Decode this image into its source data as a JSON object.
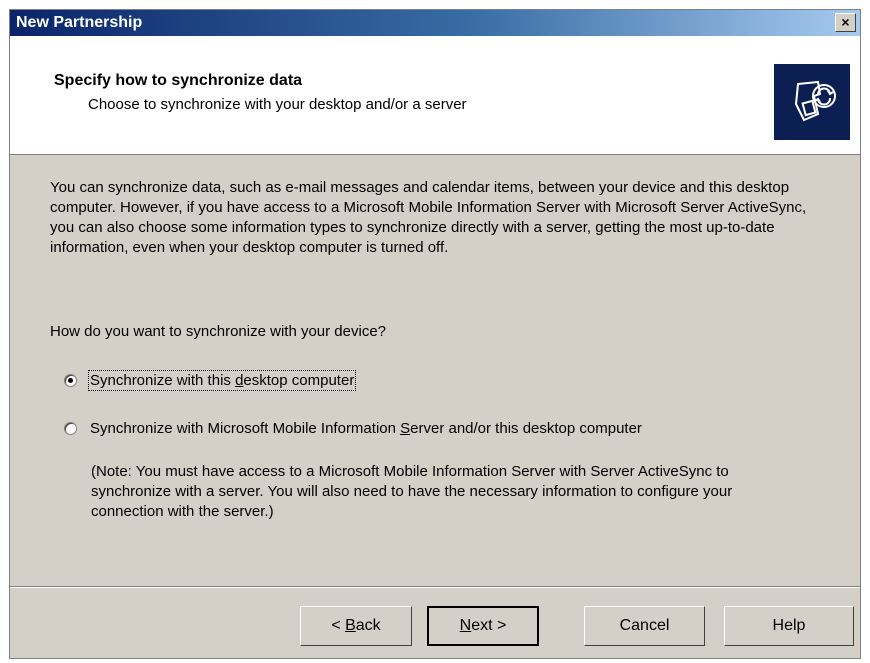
{
  "window": {
    "title": "New Partnership",
    "close_label": "×"
  },
  "header": {
    "title": "Specify how to synchronize data",
    "subtitle": "Choose to synchronize with your desktop and/or a server"
  },
  "body": {
    "paragraph": "You can synchronize data, such as e-mail messages and calendar items, between your device and this desktop computer.  However, if you have access to a Microsoft Mobile Information Server with Microsoft Server ActiveSync, you can also choose some information types to synchronize directly with a server, getting the most up-to-date information, even when your desktop computer is turned off.",
    "question": "How do you want to synchronize with your device?"
  },
  "options": [
    {
      "pre": "Synchronize with this ",
      "key": "d",
      "post": "esktop computer",
      "selected": true
    },
    {
      "pre": "Synchronize with Microsoft Mobile Information ",
      "key": "S",
      "post": "erver and/or this desktop computer",
      "selected": false
    }
  ],
  "note": "(Note: You must have access to a Microsoft Mobile Information Server with Server ActiveSync to synchronize with a server.  You will also need to have the necessary information to configure your connection with the server.)",
  "buttons": {
    "back": {
      "pre": "< ",
      "key": "B",
      "post": "ack"
    },
    "next": {
      "pre": "",
      "key": "N",
      "post": "ext >"
    },
    "cancel": "Cancel",
    "help": "Help"
  },
  "icons": {
    "logo": "activesync-device-icon"
  },
  "colors": {
    "title_bar_start": "#0a246a",
    "title_bar_end": "#a6caf0",
    "dialog_face": "#d4d0c8",
    "logo_bg": "#0b1f52"
  }
}
